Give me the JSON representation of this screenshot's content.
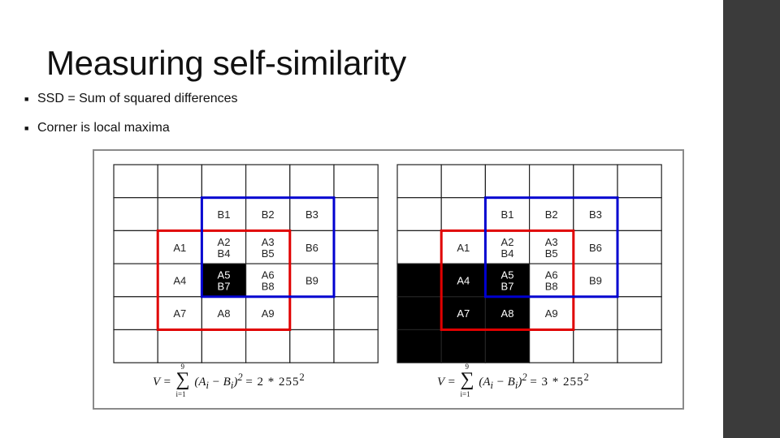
{
  "title": "Measuring self-similarity",
  "bullets": [
    "SSD = Sum of squared differences",
    "Corner is local maxima"
  ],
  "colors": {
    "sidebar": "#3b3b3b",
    "window_a": "#e00000",
    "window_b": "#0000d0",
    "dark_pixel": "#000000"
  },
  "figures": [
    {
      "labels": [
        [
          "",
          "",
          "",
          "",
          "",
          ""
        ],
        [
          "",
          "",
          "B1",
          "B2",
          "B3",
          ""
        ],
        [
          "",
          "A1",
          "A2\nB4",
          "A3\nB5",
          "B6",
          ""
        ],
        [
          "",
          "A4",
          "A5\nB7",
          "A6\nB8",
          "B9",
          ""
        ],
        [
          "",
          "A7",
          "A8",
          "A9",
          "",
          ""
        ],
        [
          "",
          "",
          "",
          "",
          "",
          ""
        ]
      ],
      "dark": [
        [
          3,
          2
        ]
      ],
      "formula": {
        "lhs": "V =",
        "sum_top": "9",
        "sum_bottom": "i=1",
        "body": "(A",
        "sub": "i",
        "minus": " − B",
        "close": ")",
        "sq": "2",
        "rhs": "= 2 * 255",
        "rhs_sq": "2"
      }
    },
    {
      "labels": [
        [
          "",
          "",
          "",
          "",
          "",
          ""
        ],
        [
          "",
          "",
          "B1",
          "B2",
          "B3",
          ""
        ],
        [
          "",
          "A1",
          "A2\nB4",
          "A3\nB5",
          "B6",
          ""
        ],
        [
          "",
          "A4",
          "A5\nB7",
          "A6\nB8",
          "B9",
          ""
        ],
        [
          "",
          "A7",
          "A8",
          "A9",
          "",
          ""
        ],
        [
          "",
          "",
          "",
          "",
          "",
          ""
        ]
      ],
      "dark": [
        [
          3,
          0
        ],
        [
          3,
          1
        ],
        [
          3,
          2
        ],
        [
          4,
          0
        ],
        [
          4,
          1
        ],
        [
          4,
          2
        ],
        [
          5,
          0
        ],
        [
          5,
          1
        ],
        [
          5,
          2
        ]
      ],
      "formula": {
        "lhs": "V =",
        "sum_top": "9",
        "sum_bottom": "i=1",
        "body": "(A",
        "sub": "i",
        "minus": " − B",
        "close": ")",
        "sq": "2",
        "rhs": "= 3 * 255",
        "rhs_sq": "2"
      }
    }
  ]
}
